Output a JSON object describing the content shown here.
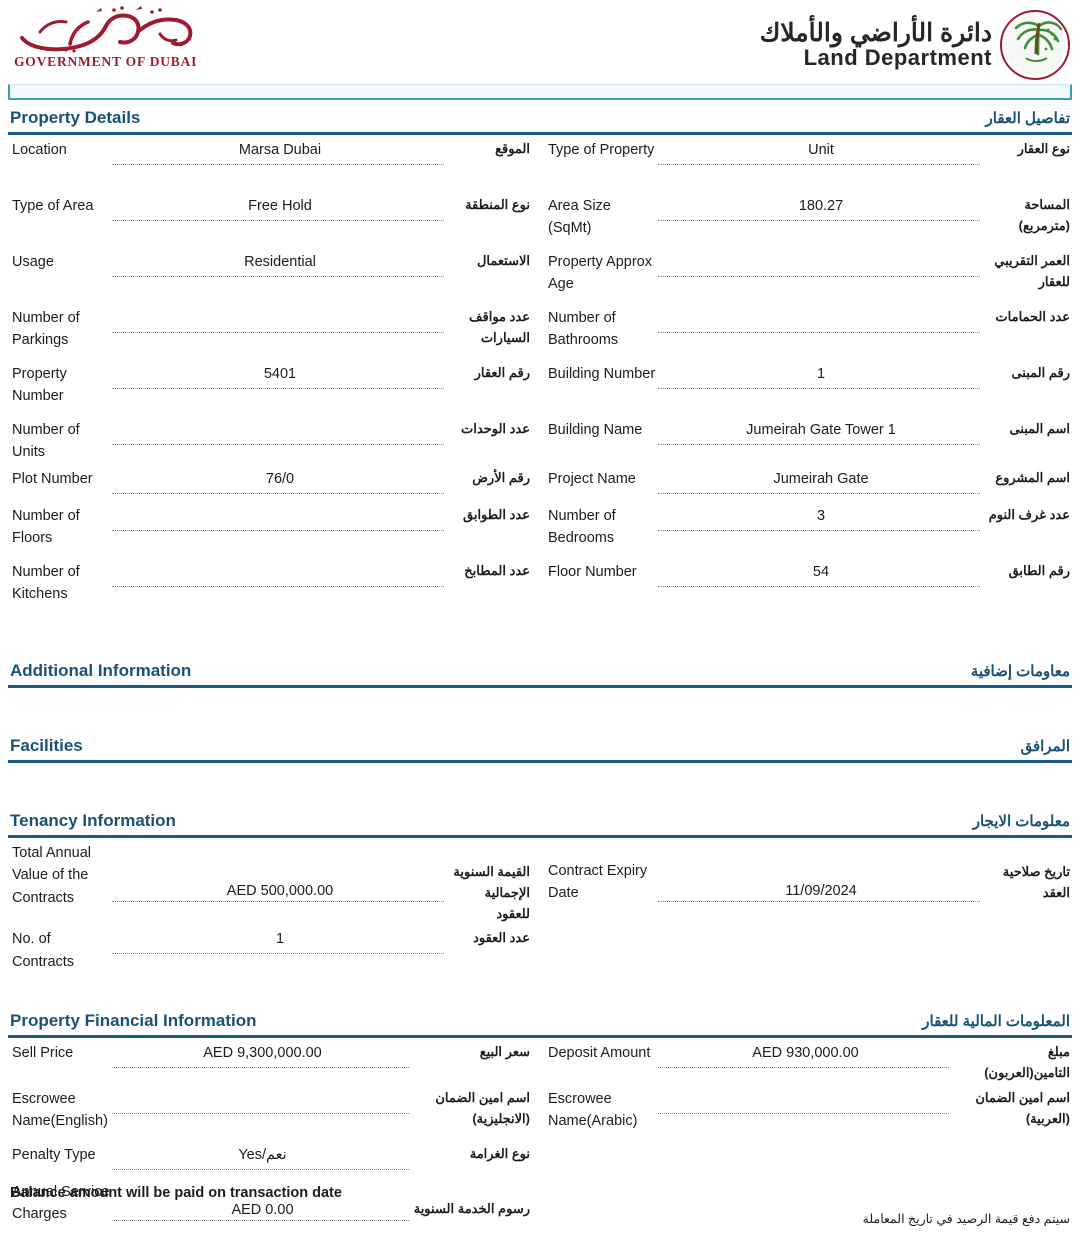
{
  "header": {
    "gov_logo_en": "GOVERNMENT OF DUBAI",
    "gov_logo_ar": "حكومة دبي",
    "land_dept_ar": "دائرة الأراضي والأملاك",
    "land_dept_en": "Land Department",
    "emblem": "palm-tree-emblem-icon"
  },
  "sections": {
    "property_details": {
      "title_en": "Property Details",
      "title_ar": "تفاصيل العقار",
      "rows": [
        {
          "left": {
            "label_en": "Location",
            "value": "Marsa Dubai",
            "label_ar": "الموقع"
          },
          "right": {
            "label_en": "Type of Property",
            "value": "Unit",
            "label_ar": "نوع العقار"
          }
        },
        {
          "left": {
            "label_en": "Type of Area",
            "value": "Free Hold",
            "label_ar": "نوع المنطقة"
          },
          "right": {
            "label_en": "Area Size (SqMt)",
            "value": "180.27",
            "label_ar": "المساحة (مترمربع)"
          }
        },
        {
          "left": {
            "label_en": "Usage",
            "value": "Residential",
            "label_ar": "الاستعمال"
          },
          "right": {
            "label_en": "Property Approx Age",
            "value": "",
            "label_ar": "العمر التقريبي للعقار"
          }
        },
        {
          "left": {
            "label_en": "Number of Parkings",
            "value": "",
            "label_ar": "عدد مواقف السيارات"
          },
          "right": {
            "label_en": "Number of Bathrooms",
            "value": "",
            "label_ar": "عدد الحمامات"
          }
        },
        {
          "left": {
            "label_en": "Property Number",
            "value": "5401",
            "label_ar": "رقم العقار"
          },
          "right": {
            "label_en": "Building Number",
            "value": "1",
            "label_ar": "رقم المبنى"
          }
        },
        {
          "left": {
            "label_en": "Number of Units",
            "value": "",
            "label_ar": "عدد الوحدات"
          },
          "right": {
            "label_en": "Building Name",
            "value": "Jumeirah Gate Tower 1",
            "label_ar": "اسم المبنى"
          }
        },
        {
          "left": {
            "label_en": "Plot Number",
            "value": "76/0",
            "label_ar": "رقم الأرض"
          },
          "right": {
            "label_en": "Project Name",
            "value": "Jumeirah Gate",
            "label_ar": "اسم المشروع"
          }
        },
        {
          "left": {
            "label_en": "Number of Floors",
            "value": "",
            "label_ar": "عدد الطوابق"
          },
          "right": {
            "label_en": "Number of Bedrooms",
            "value": "3",
            "label_ar": "عدد غرف النوم"
          }
        },
        {
          "left": {
            "label_en": "Number of Kitchens",
            "value": "",
            "label_ar": "عدد المطابخ"
          },
          "right": {
            "label_en": "Floor Number",
            "value": "54",
            "label_ar": "رقم الطابق"
          }
        }
      ]
    },
    "additional_information": {
      "title_en": "Additional Information",
      "title_ar": "معاومات إضافية"
    },
    "facilities": {
      "title_en": "Facilities",
      "title_ar": "المرافق"
    },
    "tenancy_information": {
      "title_en": "Tenancy Information",
      "title_ar": "معلومات الايجار",
      "rows": [
        {
          "left": {
            "label_en": "Total Annual Value of the Contracts",
            "value": "AED 500,000.00",
            "label_ar": "القيمة السنوية الإجمالية للعقود"
          },
          "right": {
            "label_en": "Contract Expiry Date",
            "value": "11/09/2024",
            "label_ar": "تاريخ صلاحية العقد"
          }
        },
        {
          "left": {
            "label_en": "No. of Contracts",
            "value": "1",
            "label_ar": "عدد العقود"
          },
          "right": {
            "label_en": "",
            "value": "",
            "label_ar": ""
          }
        }
      ]
    },
    "property_financial_information": {
      "title_en": "Property Financial Information",
      "title_ar": "المعلومات المالية للعقار",
      "rows": [
        {
          "left": {
            "label_en": "Sell Price",
            "value": "AED 9,300,000.00",
            "label_ar": "سعر البيع"
          },
          "right": {
            "label_en": "Deposit Amount",
            "value": "AED 930,000.00",
            "label_ar": "مبلغ التامين(العربون)"
          }
        },
        {
          "left": {
            "label_en": "Escrowee Name(English)",
            "value": "",
            "label_ar": "اسم امين الضمان (الانجليزية)"
          },
          "right": {
            "label_en": "Escrowee Name(Arabic)",
            "value": "",
            "label_ar": "اسم امين الضمان (العربية)"
          }
        },
        {
          "left": {
            "label_en": "Penalty Type",
            "value": "Yes/نعم",
            "label_ar": "نوع الغرامة"
          },
          "right": {
            "label_en": "",
            "value": "",
            "label_ar": ""
          }
        },
        {
          "left": {
            "label_en": "Annual Service Charges",
            "value": "AED 0.00",
            "label_ar": "رسوم الخدمة السنوية"
          },
          "right": {
            "label_en": "",
            "value": "",
            "label_ar": ""
          }
        }
      ]
    }
  },
  "footer": {
    "note_en": "Balance amount will be paid on transaction date",
    "note_ar": "سيتم دفع قيمة الرصيد في تاريخ المعاملة"
  },
  "colors": {
    "section_blue": "#1a5276",
    "rule_blue": "#1d5b89",
    "gov_red": "#9e1b32",
    "teal_bar": "#3a9bb5"
  }
}
